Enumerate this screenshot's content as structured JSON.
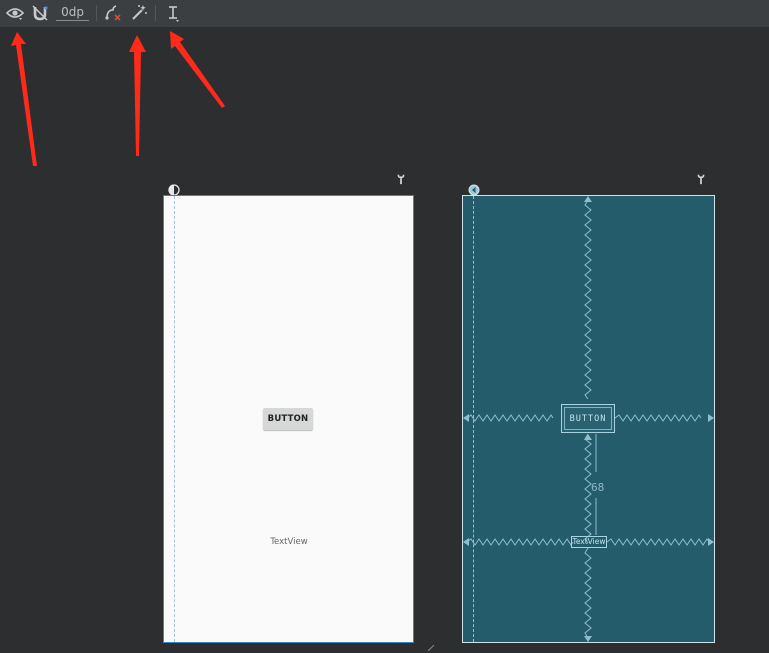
{
  "toolbar": {
    "margin_value": "0dp",
    "icons": [
      "eye-icon",
      "magnet-icon",
      "clear-constraints-icon",
      "magic-wand-icon",
      "baseline-icon"
    ]
  },
  "design_view": {
    "button_label": "BUTTON",
    "textview_label": "TextView"
  },
  "blueprint_view": {
    "button_label": "BUTTON",
    "textview_label": "TextView",
    "margin_dimension": "68"
  },
  "colors": {
    "annotation_arrow": "#ff2a1a",
    "blueprint_bg": "#245c6b",
    "toolbar_bg": "#3c3f41"
  }
}
